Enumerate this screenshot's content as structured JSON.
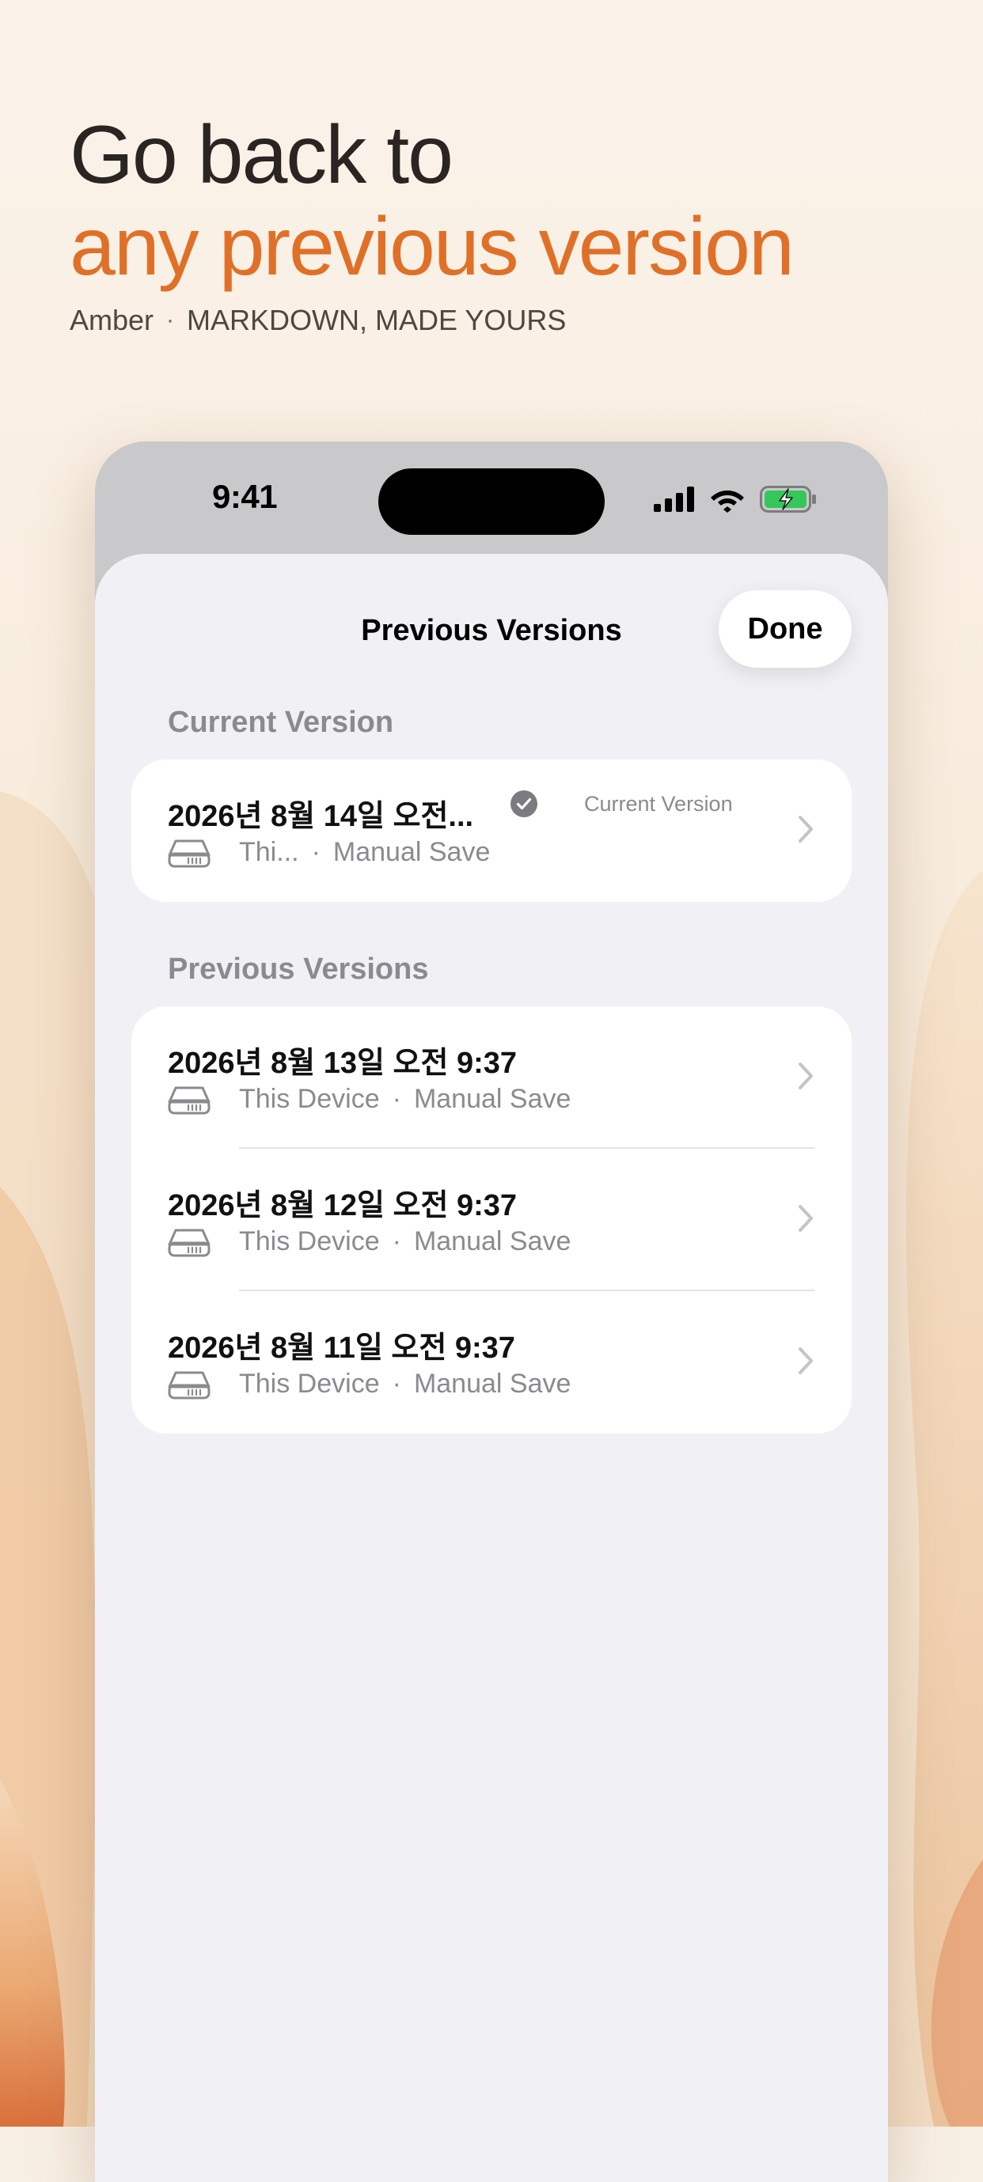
{
  "hero": {
    "line1": "Go back to",
    "line2": "any previous version",
    "app_name": "Amber",
    "separator": "·",
    "tagline": "MARKDOWN, MADE YOURS"
  },
  "status_bar": {
    "time": "9:41",
    "icons": [
      "cellular-signal-icon",
      "wifi-icon",
      "battery-charging-icon"
    ]
  },
  "sheet": {
    "title": "Previous Versions",
    "done_label": "Done",
    "current_section": {
      "header": "Current Version",
      "item": {
        "title": "2026년 8월 14일 오전...",
        "badge": "Current Version",
        "source": "Thi...",
        "separator": "·",
        "save_type": "Manual Save"
      }
    },
    "previous_section": {
      "header": "Previous Versions",
      "items": [
        {
          "title": "2026년 8월 13일 오전 9:37",
          "source": "This Device",
          "separator": "·",
          "save_type": "Manual Save"
        },
        {
          "title": "2026년 8월 12일 오전 9:37",
          "source": "This Device",
          "separator": "·",
          "save_type": "Manual Save"
        },
        {
          "title": "2026년 8월 11일 오전 9:37",
          "source": "This Device",
          "separator": "·",
          "save_type": "Manual Save"
        }
      ]
    }
  },
  "colors": {
    "accent": "#e07028",
    "headline": "#2a2522",
    "battery": "#34c759",
    "secondary_text": "#8a8a8f"
  }
}
